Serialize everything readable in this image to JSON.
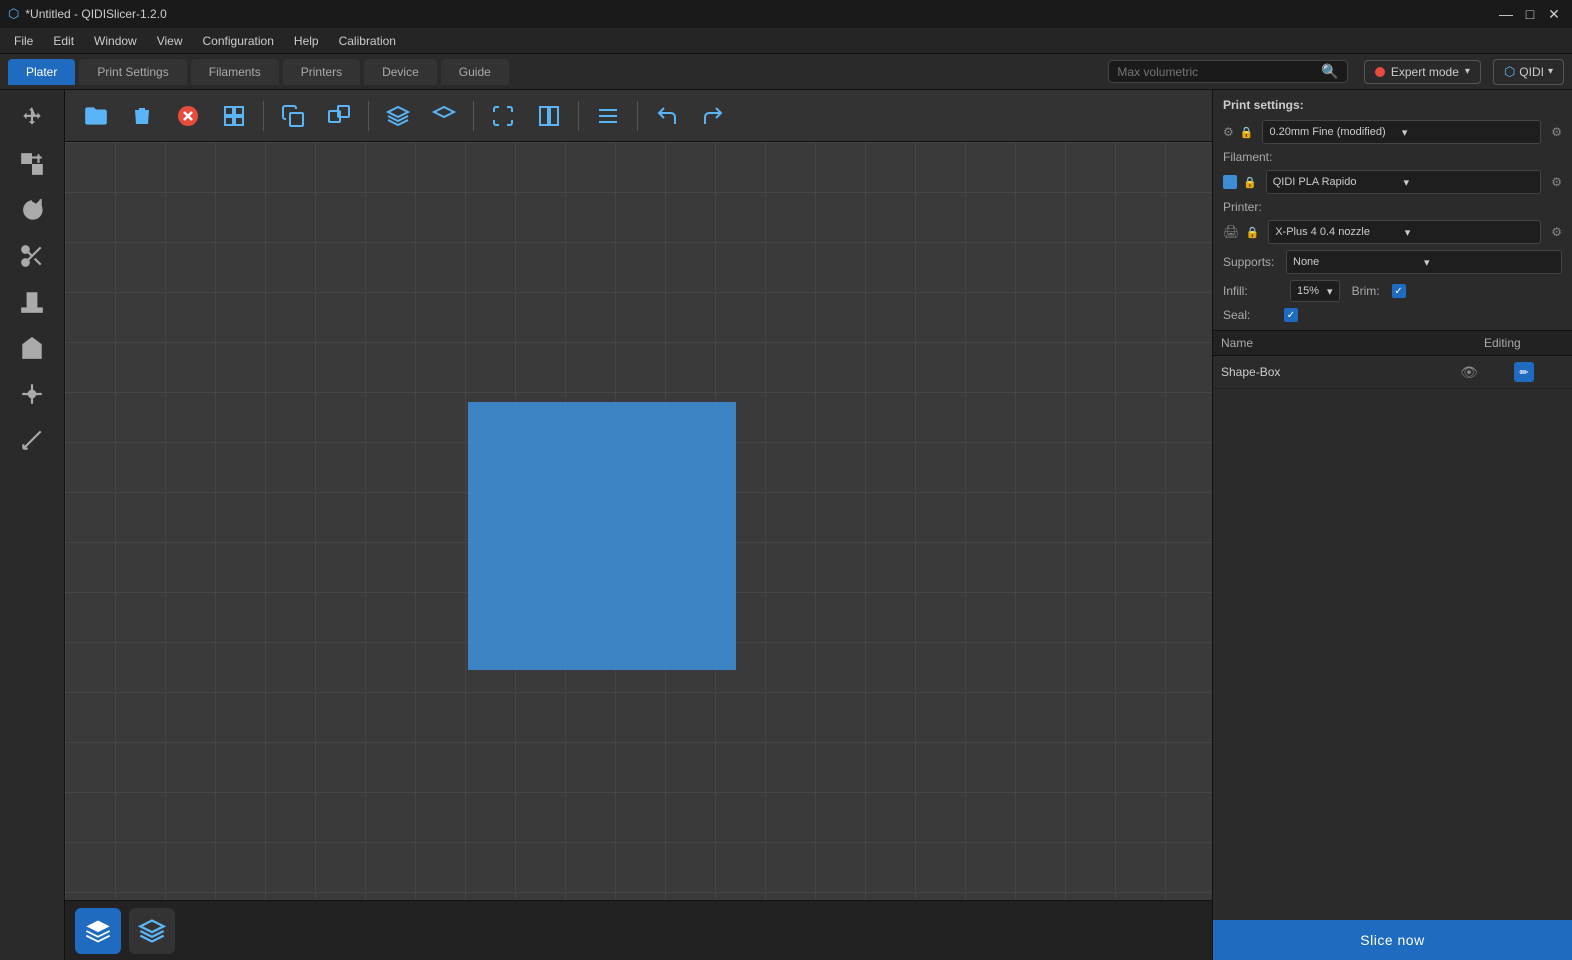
{
  "titlebar": {
    "title": "*Untitled - QIDISlicer-1.2.0",
    "minimize": "—",
    "maximize": "□",
    "close": "✕"
  },
  "menubar": {
    "items": [
      "File",
      "Edit",
      "Window",
      "View",
      "Configuration",
      "Help",
      "Calibration"
    ]
  },
  "tabs": {
    "items": [
      "Plater",
      "Print Settings",
      "Filaments",
      "Printers",
      "Device",
      "Guide"
    ],
    "active": 0
  },
  "search": {
    "placeholder": "Max volumetric"
  },
  "expert_mode": {
    "label": "Expert mode"
  },
  "qidi": {
    "label": "QIDI"
  },
  "print_settings": {
    "title": "Print settings:",
    "quality": "0.20mm Fine (modified)",
    "filament_label": "Filament:",
    "filament": "QIDI PLA Rapido",
    "printer_label": "Printer:",
    "printer": "X-Plus 4 0.4 nozzle",
    "supports_label": "Supports:",
    "supports_value": "None",
    "infill_label": "Infill:",
    "infill_value": "15%",
    "brim_label": "Brim:",
    "seal_label": "Seal:"
  },
  "object_list": {
    "col_name": "Name",
    "col_editing": "Editing",
    "rows": [
      {
        "name": "Shape-Box",
        "visible": true,
        "editing": true
      }
    ]
  },
  "slice_btn": "Slice now",
  "toolbar": {
    "open": "📁",
    "delete": "🗑",
    "delete_all": "✕",
    "arrange": "⊞",
    "copy": "📋",
    "instance": "⧉",
    "view3d": "⬛",
    "view_top": "⬛",
    "split": "⊟",
    "cut": "✂",
    "undo": "↩",
    "redo": "↪"
  }
}
